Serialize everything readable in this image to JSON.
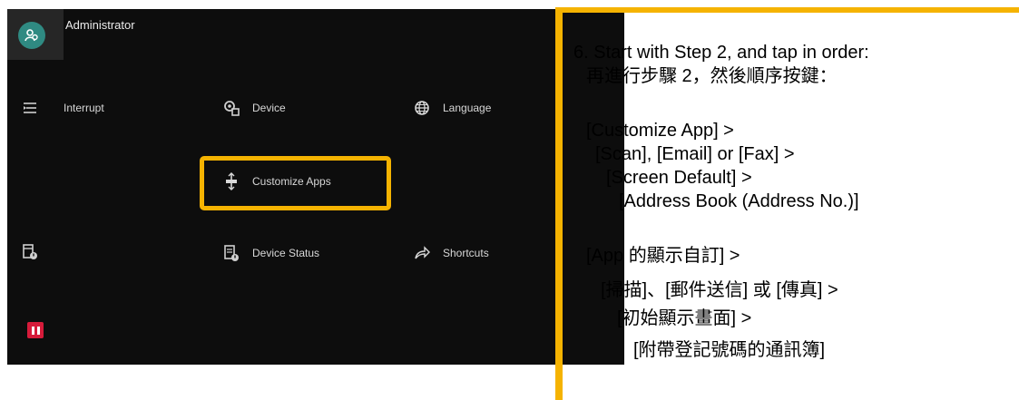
{
  "panel": {
    "user_label": "Administrator",
    "menu": {
      "interrupt": "Interrupt",
      "device": "Device",
      "language": "Language",
      "customize_apps": "Customize Apps",
      "device_status": "Device Status",
      "shortcuts": "Shortcuts"
    },
    "icons": {
      "avatar": "user-avatar-icon",
      "interrupt": "interrupt-icon",
      "device": "device-icon",
      "language": "globe-icon",
      "customize_apps": "customize-icon",
      "device_status": "device-status-icon",
      "shortcuts": "share-arrow-icon",
      "left_lock": "printer-lock-icon",
      "pause": "pause-icon"
    },
    "colors": {
      "background": "#0d0d0d",
      "highlight": "#f5b301",
      "avatar": "#2f8a82",
      "pause": "#d61b3a"
    }
  },
  "instructions": {
    "step_title": "6. Start with Step 2, and tap in order:",
    "step_title_zh": "再進行步驟 2，然後順序按鍵：",
    "en_lines": [
      "[Customize App] >",
      "[Scan], [Email] or [Fax] >",
      "[Screen Default] >",
      "[Address Book (Address No.)]"
    ],
    "zh_lines": [
      "[App 的顯示自訂] >",
      "[掃描]、[郵件送信] 或 [傳真] >",
      "[初始顯示畫面] >",
      "[附帶登記號碼的通訊簿]"
    ]
  }
}
